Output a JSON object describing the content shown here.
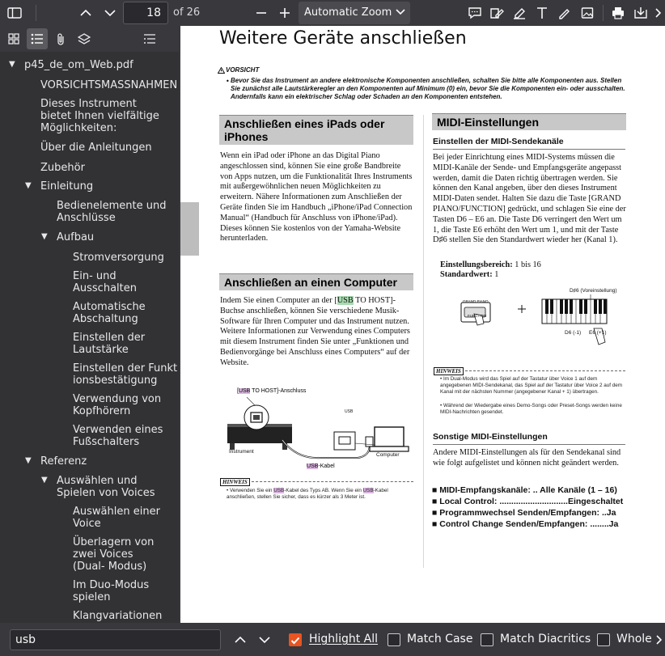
{
  "toolbar": {
    "page_number": "18",
    "page_count": "of 26",
    "zoom_value": "Automatic Zoom"
  },
  "sidebar": {
    "file_name": "p45_de_om_Web.pdf",
    "items": [
      {
        "label": "VORSICHTSMASSNAHMEN"
      },
      {
        "label": "Dieses Instrument bietet Ihnen vielfältige Möglichkeiten:"
      },
      {
        "label": "Über die Anleitungen"
      },
      {
        "label": "Zubehör"
      },
      {
        "label": "Einleitung"
      },
      {
        "label": "Bedienelemente und Anschlüsse"
      },
      {
        "label": "Aufbau"
      },
      {
        "label": "Stromversorgung"
      },
      {
        "label": "Ein- und Ausschalten"
      },
      {
        "label": "Automatische Abschaltung"
      },
      {
        "label": "Einstellen der Lautstärke"
      },
      {
        "label": "Einstellen der Funktionsbestätigung"
      },
      {
        "label": "Verwendung von Kopfhörern"
      },
      {
        "label": "Verwenden eines Fußschalters"
      },
      {
        "label": "Referenz"
      },
      {
        "label": "Auswählen und Spielen von Voices"
      },
      {
        "label": "Auswählen einer Voice"
      },
      {
        "label": "Überlagern von zwei Voices (Dual- Modus)"
      },
      {
        "label": "Im Duo-Modus spielen"
      },
      {
        "label": "Klangvariationen"
      }
    ]
  },
  "doc": {
    "title": "Weitere Geräte anschließen",
    "caution_label": "VORSICHT",
    "caution_text": "Bevor Sie das Instrument an andere elektronische Komponenten anschließen, schalten Sie bitte alle Komponenten aus. Stellen Sie zunächst alle Lautstärkeregler an den Komponenten auf Minimum (0) ein, bevor Sie die Komponenten ein- oder ausschalten. Andernfalls kann ein elektrischer Schlag oder Schaden an den Komponenten entstehen.",
    "ipad_heading": "Anschließen eines iPads oder iPhones",
    "ipad_text": "Wenn ein iPad oder iPhone an das Digital Piano angeschlossen sind, können Sie eine große Bandbreite von Apps nutzen, um die Funktionalität Ihres Instruments mit außergewöhnlichen neuen Möglichkeiten zu erweitern. Nähere Informationen zum Anschließen der Geräte finden Sie im Handbuch „iPhone/iPad Connection Manual“ (Handbuch für Anschluss von iPhone/iPad). Dieses können Sie kostenlos von der Yamaha-Website herunterladen.",
    "computer_heading": "Anschließen an einen Computer",
    "computer_text_1": "Indem Sie einen Computer an der [",
    "computer_usb_1": "USB",
    "computer_text_2": " TO HOST]-Buchse anschließen, können Sie verschiedene Musik-Software für Ihren Computer und das Instrument nutzen.",
    "computer_text_3": "Weitere Informationen zur Verwendung eines Computers mit diesem Instrument finden Sie unter „Funktionen und Bedienvorgänge bei Anschluss eines Computers“ auf der Website.",
    "fig_usb_1": "USB",
    "fig_label_port": " TO HOST]-Anschluss",
    "fig_bracket": "[",
    "fig_instrument": "Instrument",
    "fig_computer": "Computer",
    "fig_usb_small": "USB",
    "fig_usb_2": "USB",
    "fig_cable": "-Kabel",
    "hinweis_label": "HINWEIS",
    "hinweis_left_1": "Verwenden Sie ein ",
    "hinweis_left_usb_1": "USB",
    "hinweis_left_2": "-Kabel des Typs AB. Wenn Sie ein ",
    "hinweis_left_usb_2": "USB",
    "hinweis_left_3": "-Kabel anschließen, stellen Sie sicher, dass es kürzer als 3 Meter ist.",
    "midi_heading": "MIDI-Einstellungen",
    "midi_sub1": "Einstellen der MIDI-Sendekanäle",
    "midi_text": "Bei jeder Einrichtung eines MIDI-Systems müssen die MIDI-Kanäle der Sende- und Empfangsgeräte angepasst werden, damit die Daten richtig übertragen werden. Sie können den Kanal angeben, über den dieses Instrument MIDI-Daten sendet. Halten Sie dazu die Taste [GRAND PIANO/FUNCTION] gedrückt, und schlagen Sie eine der Tasten D6 – E6 an. Die Taste D6 verringert den Wert um 1, die Taste E6 erhöht den Wert um 1, und mit der Taste D♯6 stellen Sie den Standardwert wieder her (Kanal 1).",
    "range_label": "Einstellungsbereich:",
    "range_value": " 1 bis 16",
    "default_label": "Standardwert:",
    "default_value": " 1",
    "kb_d6sharp": "D♯6 (Voreinstellung)",
    "kb_d6": "D6 (-1)",
    "kb_e6": "E6 (+1)",
    "kb_grand": "GRAND PIANO",
    "kb_function": "FUNCTION",
    "hinweis_right_1": "Im Dual-Modus wird das Spiel auf der Tastatur über Voice 1 auf dem angegebenen MIDI-Sendekanal, das Spiel auf der Tastatur über Voice 2 auf dem Kanal mit der nächsten Nummer (angegebener Kanal + 1) übertragen.",
    "hinweis_right_2": "Während der Wiedergabe eines Demo-Songs oder Preset-Songs werden keine MIDI-Nachrichten gesendet.",
    "midi_sub2": "Sonstige MIDI-Einstellungen",
    "midi_text2": "Andere MIDI-Einstellungen als für den Sendekanal sind wie folgt aufgelistet und können nicht geändert werden.",
    "settings": [
      "■ MIDI-Empfangskanäle: .. Alle Kanäle (1 – 16)",
      "■ Local Control: .............................Eingeschaltet",
      "■ Programmwechsel Senden/Empfangen: ..Ja",
      "■ Control Change Senden/Empfangen: ........Ja"
    ]
  },
  "findbar": {
    "query": "usb",
    "highlight_all": "Highlight All",
    "match_case": "Match Case",
    "match_diacritics": "Match Diacritics",
    "whole_words": "Whole"
  },
  "colors": {
    "accent": "#e95420",
    "highlight": "#d9b5df",
    "selected_highlight": "#a8dbb0"
  }
}
